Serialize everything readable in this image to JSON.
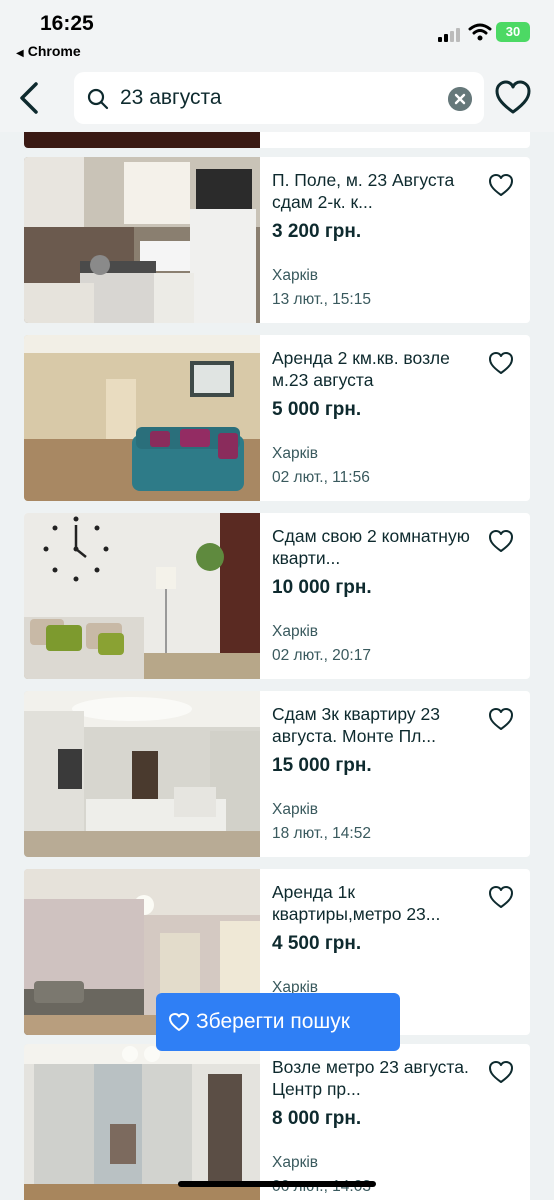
{
  "status": {
    "time": "16:25",
    "back_app": "Chrome",
    "battery": "30"
  },
  "search": {
    "query": "23 августа"
  },
  "listings": [
    {
      "title": "П. Поле, м. 23 Августа сдам 2-к. к...",
      "price": "3 200 грн.",
      "city": "Харків",
      "date": "13 лют., 15:15"
    },
    {
      "title": "Аренда 2 км.кв. возле м.23 августа",
      "price": "5 000 грн.",
      "city": "Харків",
      "date": "02 лют., 11:56"
    },
    {
      "title": "Сдам свою 2 комнатную кварти...",
      "price": "10 000 грн.",
      "city": "Харків",
      "date": "02 лют., 20:17"
    },
    {
      "title": "Сдам 3к квартиру 23 августа. Монте Пл...",
      "price": "15 000 грн.",
      "city": "Харків",
      "date": "18 лют., 14:52"
    },
    {
      "title": "Аренда 1к квартиры,метро 23...",
      "price": "4 500 грн.",
      "city": "Харків",
      "date": ""
    },
    {
      "title": "Возле метро 23 августа. Центр пр...",
      "price": "8 000 грн.",
      "city": "Харків",
      "date": "06 лют., 14:03"
    }
  ],
  "save_search": {
    "label": "Зберегти пошук"
  },
  "colors": {
    "accent": "#2f7ff5",
    "text": "#0e2a2e",
    "background": "#eef2f3"
  },
  "icons": [
    "back-arrow-icon",
    "search-icon",
    "clear-icon",
    "heart-icon"
  ]
}
